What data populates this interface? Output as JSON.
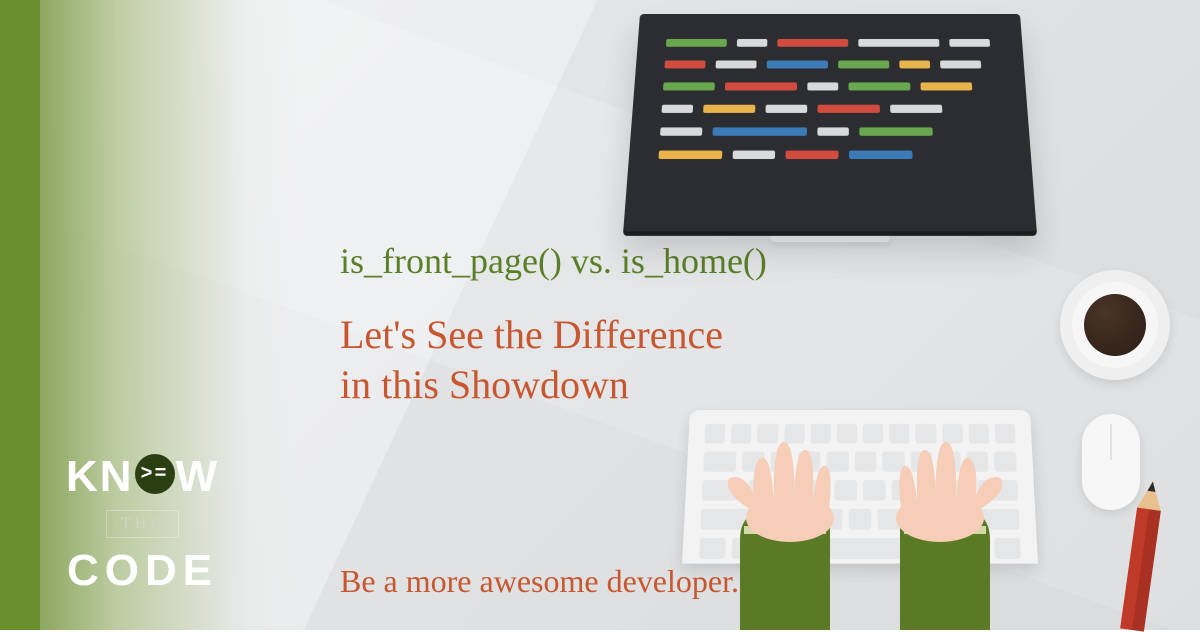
{
  "logo": {
    "top": "KN",
    "o_glyph": ">=",
    "top2": "W",
    "the": "THE",
    "bottom": "CODE"
  },
  "title": "is_front_page() vs. is_home()",
  "subtitle": "Let's See the Difference\nin this Showdown",
  "tagline": "Be a more awesome developer.",
  "colors": {
    "green": "#5a8027",
    "orange": "#c8572f",
    "bar": "#6a8f2d",
    "code_green": "#6aa84f",
    "code_red": "#d14b3f",
    "code_yellow": "#e9b44c",
    "code_blue": "#3d7ab8",
    "code_white": "#d8d9db"
  }
}
